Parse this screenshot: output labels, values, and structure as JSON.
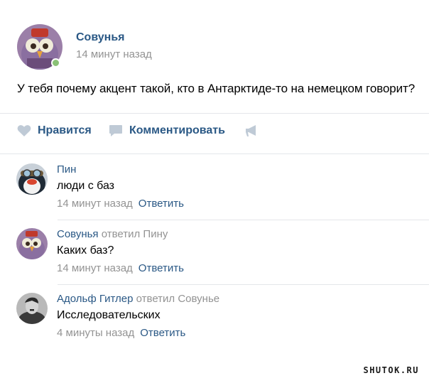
{
  "post": {
    "author": "Совунья",
    "time": "14 минут назад",
    "text": "У тебя почему акцент такой, кто в Антарктиде-то на немецком говорит?",
    "avatar_icon": "owl-avatar",
    "online": true
  },
  "actions": {
    "like_label": "Нравится",
    "comment_label": "Комментировать",
    "like_icon": "heart-icon",
    "comment_icon": "speech-bubble-icon",
    "share_icon": "megaphone-icon"
  },
  "comments": [
    {
      "author": "Пин",
      "reply_to": "",
      "text": "люди с баз",
      "time": "14 минут назад",
      "answer": "Ответить",
      "avatar_icon": "penguin-avatar"
    },
    {
      "author": "Совунья",
      "reply_to": "ответил Пину",
      "text": "Каких баз?",
      "time": "14 минут назад",
      "answer": "Ответить",
      "avatar_icon": "owl-avatar"
    },
    {
      "author": "Адольф Гитлер",
      "reply_to": "ответил Совунье",
      "text": "Исследовательских",
      "time": "4 минуты назад",
      "answer": "Ответить",
      "avatar_icon": "bw-portrait-avatar"
    }
  ],
  "colors": {
    "link": "#2a5885",
    "muted": "#939393",
    "divider": "#e4e6ea",
    "icon": "#bfcad6",
    "online": "#8ac176"
  },
  "watermark": "SHUTOK.RU"
}
